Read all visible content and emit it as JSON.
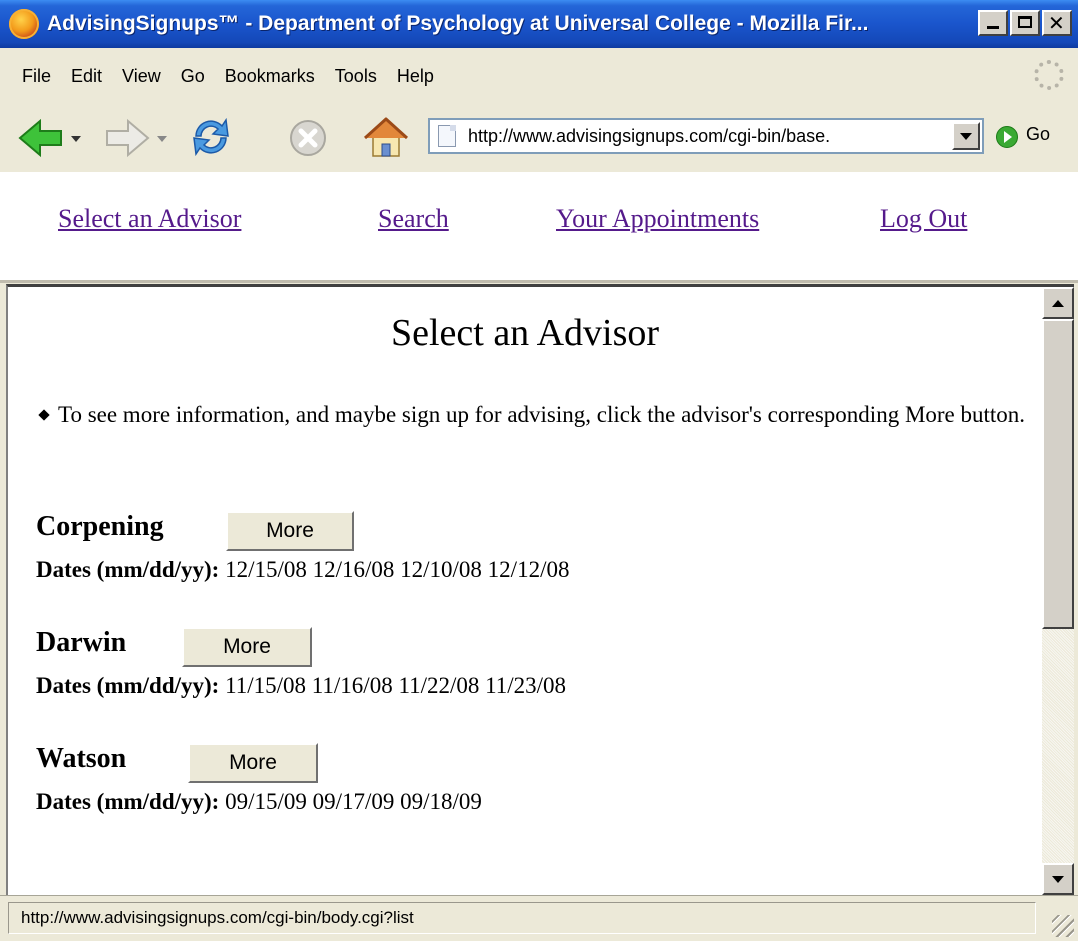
{
  "window": {
    "title": "AdvisingSignups™ - Department of Psychology at Universal College - Mozilla Fir..."
  },
  "menu": {
    "items": [
      "File",
      "Edit",
      "View",
      "Go",
      "Bookmarks",
      "Tools",
      "Help"
    ]
  },
  "toolbar": {
    "url": "http://www.advisingsignups.com/cgi-bin/base.",
    "go_label": "Go",
    "icons": [
      "back-arrow-icon",
      "forward-arrow-icon",
      "reload-icon",
      "stop-icon",
      "home-icon"
    ]
  },
  "topnav": {
    "links": [
      "Select an Advisor",
      "Search",
      "Your Appointments",
      "Log Out"
    ]
  },
  "main": {
    "title": "Select an Advisor",
    "intro": "To see more information, and maybe sign up for advising, click the advisor's corresponding More button.",
    "dates_label": "Dates (mm/dd/yy):",
    "more_label": "More",
    "advisors": [
      {
        "name": "Corpening",
        "dates": "12/15/08 12/16/08 12/10/08 12/12/08"
      },
      {
        "name": "Darwin",
        "dates": "11/15/08 11/16/08 11/22/08 11/23/08"
      },
      {
        "name": "Watson",
        "dates": "09/15/09 09/17/09 09/18/09"
      }
    ]
  },
  "status": {
    "text": "http://www.advisingsignups.com/cgi-bin/body.cgi?list"
  },
  "colors": {
    "titlebar": "#1a55cc",
    "visited_link": "#551a8b",
    "chrome": "#ece9d8"
  }
}
